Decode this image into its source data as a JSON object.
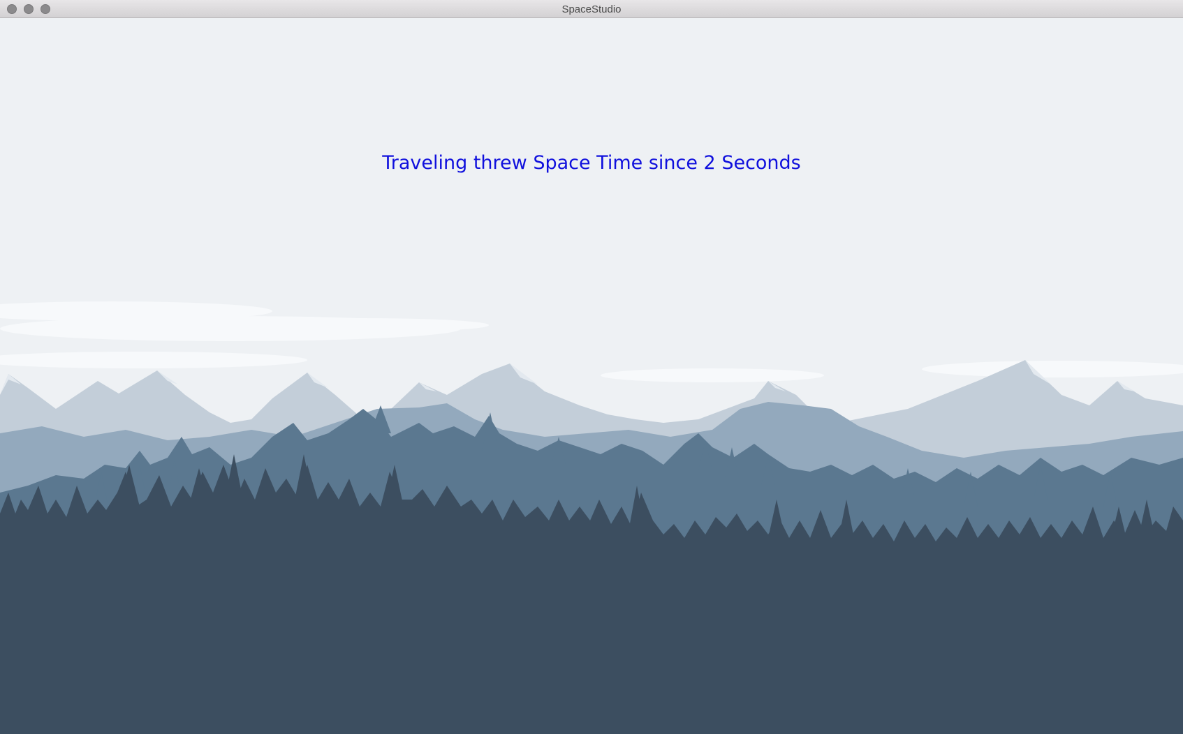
{
  "window": {
    "title": "SpaceStudio"
  },
  "main": {
    "status_text": "Traveling threw Space Time since 2 Seconds"
  },
  "colors": {
    "sky": "#eef1f4",
    "far_mountains": "#c3ced9",
    "mid_hills": "#93a9bd",
    "near_trees": "#5b7890",
    "forest": "#3c4e60",
    "text": "#1010dd"
  }
}
